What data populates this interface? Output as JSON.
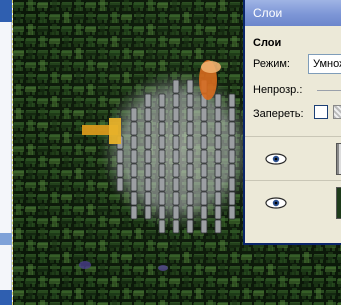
{
  "palette": {
    "window_title": "Слои",
    "panel_title": "Слои",
    "mode_label": "Режим:",
    "mode_value": "Умножение",
    "opacity_label": "Непрозр.:",
    "lock_label": "Запереть:"
  },
  "layers": [
    {
      "visible": true,
      "thumbnail": "weave-pattern"
    },
    {
      "visible": true,
      "thumbnail": "grass-photo"
    }
  ],
  "colors": {
    "titlebar": "#7d96d6",
    "palette_bg": "#ece9d8",
    "selection_blue": "#2f5fb0"
  }
}
